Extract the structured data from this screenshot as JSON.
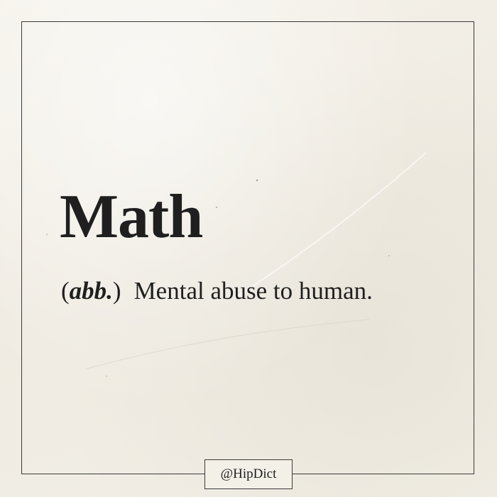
{
  "entry": {
    "word": "Math",
    "pos_open": "(",
    "pos": "abb.",
    "pos_close": ")",
    "definition": "Mental abuse to human."
  },
  "footer": {
    "handle": "@HipDict"
  },
  "colors": {
    "paper": "#f3f0e8",
    "ink": "#1f1f1f",
    "frame": "#3a3a3a"
  }
}
